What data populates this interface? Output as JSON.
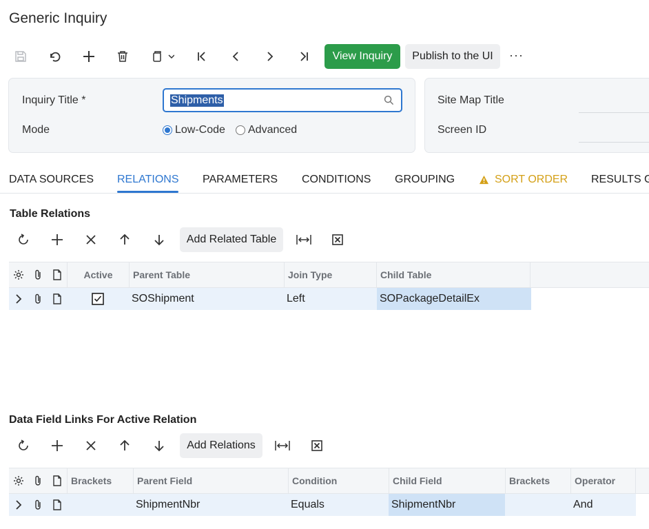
{
  "page": {
    "title": "Generic Inquiry"
  },
  "toolbar": {
    "view_inquiry": "View Inquiry",
    "publish": "Publish to the UI",
    "more": "···"
  },
  "form": {
    "inquiry_title_label": "Inquiry Title *",
    "inquiry_title_value": "Shipments",
    "mode_label": "Mode",
    "mode_low_code": "Low-Code",
    "mode_advanced": "Advanced",
    "mode_selected": "Low-Code",
    "site_map_title_label": "Site Map Title",
    "screen_id_label": "Screen ID"
  },
  "tabs": [
    {
      "label": "DATA SOURCES"
    },
    {
      "label": "RELATIONS"
    },
    {
      "label": "PARAMETERS"
    },
    {
      "label": "CONDITIONS"
    },
    {
      "label": "GROUPING"
    },
    {
      "label": "SORT ORDER"
    },
    {
      "label": "RESULTS G"
    }
  ],
  "active_tab": "RELATIONS",
  "colors": {
    "accent": "#2e77d0",
    "primary_button": "#2c9c4a",
    "warning": "#d4a017"
  },
  "table_relations": {
    "title": "Table Relations",
    "add_button": "Add Related Table",
    "columns": [
      "Active",
      "Parent Table",
      "Join Type",
      "Child Table"
    ],
    "rows": [
      {
        "active": true,
        "parent_table": "SOShipment",
        "join_type": "Left",
        "child_table": "SOPackageDetailEx"
      }
    ]
  },
  "field_links": {
    "title": "Data Field Links For Active Relation",
    "add_button": "Add Relations",
    "columns": [
      "Brackets",
      "Parent Field",
      "Condition",
      "Child Field",
      "Brackets",
      "Operator"
    ],
    "rows": [
      {
        "open_brackets": "",
        "parent_field": "ShipmentNbr",
        "condition": "Equals",
        "child_field": "ShipmentNbr",
        "close_brackets": "",
        "operator": "And"
      }
    ]
  }
}
